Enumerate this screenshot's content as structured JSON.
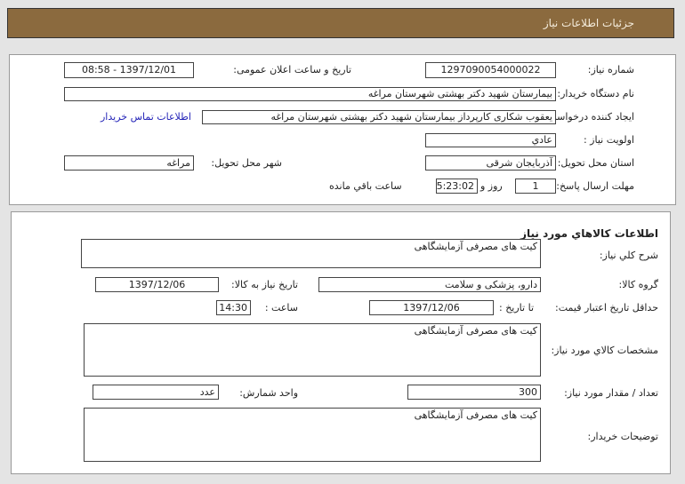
{
  "header": {
    "title": "جزئیات اطلاعات نیاز"
  },
  "need": {
    "number_label": "شماره نیاز:",
    "number": "1297090054000022",
    "announce_label": "تاریخ و ساعت اعلان عمومی:",
    "announce": "1397/12/01 - 08:58",
    "buyer_label": "نام دستگاه خریدار:",
    "buyer": "بیمارستان شهید دکتر بهشتی شهرستان مراغه",
    "creator_label": "ایجاد کننده درخواست:",
    "creator": "یعقوب شکاری کارپرداز بیمارستان شهید دکتر بهشتی شهرستان مراغه",
    "contact_link": "اطلاعات تماس خریدار",
    "priority_label": "اولویت نیاز :",
    "priority": "عادي",
    "province_label": "استان محل تحویل:",
    "province": "آذربایجان شرقی",
    "city_label": "شهر محل تحویل:",
    "city": "مراغه",
    "deadline_label": "مهلت ارسال پاسخ:",
    "days": "1",
    "days_suffix": "روز و",
    "time": "05:23:02",
    "time_suffix": "ساعت باقي مانده"
  },
  "goods": {
    "title": "اطلاعات کالاهاي مورد نياز",
    "desc_label": "شرح کلي نياز:",
    "desc": "کیت های مصرفی آزمایشگاهی",
    "group_label": "گروه کالا:",
    "group": "دارو، پزشکی و سلامت",
    "need_date_label": "تاریخ نیاز به کالا:",
    "need_date": "1397/12/06",
    "validity_label": "حداقل تاریخ اعتبار قیمت:",
    "to_date_label": "تا تاریخ :",
    "to_date": "1397/12/06",
    "hour_label": "ساعت :",
    "hour": "14:30",
    "spec_label": "مشخصات کالاي مورد نياز:",
    "spec": "کیت های مصرفی آزمایشگاهی",
    "qty_label": "تعداد / مقدار مورد نیاز:",
    "qty": "300",
    "unit_label": "واحد شمارش:",
    "unit": "عدد",
    "notes_label": "توضیحات خریدار:",
    "notes": "کیت های مصرفی آزمایشگاهی"
  }
}
